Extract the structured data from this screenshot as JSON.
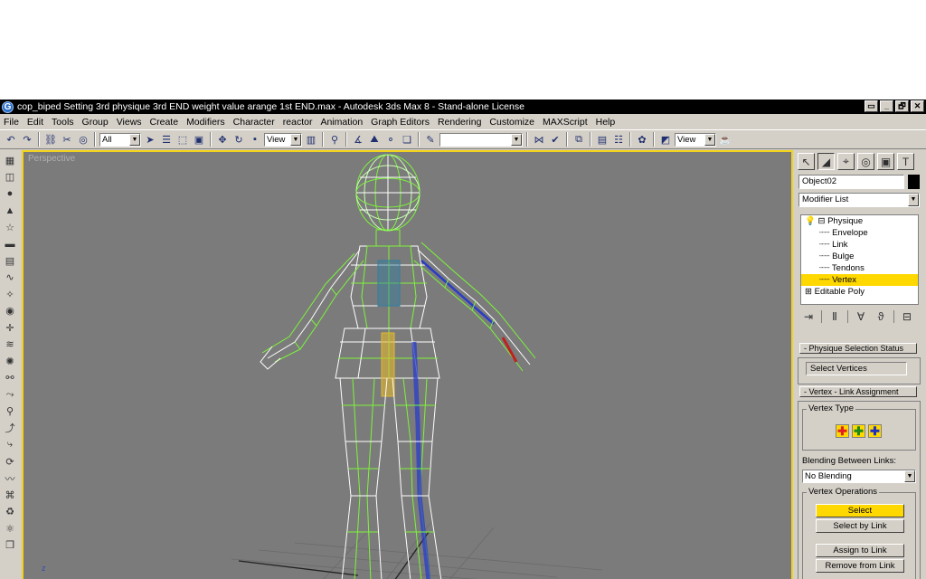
{
  "window": {
    "app_icon": "G",
    "title": "cop_biped Setting 3rd physique 3rd END weight value arange 1st END.max - Autodesk 3ds Max 8 - Stand-alone License",
    "controls": [
      "▭",
      "_",
      "🗗",
      "✕"
    ]
  },
  "menu": [
    "File",
    "Edit",
    "Tools",
    "Group",
    "Views",
    "Create",
    "Modifiers",
    "Character",
    "reactor",
    "Animation",
    "Graph Editors",
    "Rendering",
    "Customize",
    "MAXScript",
    "Help"
  ],
  "toolbar": {
    "selection_filter": "All",
    "coord_system": "View",
    "named_selection": "",
    "view_combo": "View",
    "icons": [
      "undo-icon",
      "redo-icon",
      "link-icon",
      "unlink-icon",
      "bind-space-warp-icon",
      "select-object-icon",
      "select-by-name-icon",
      "rect-selection-icon",
      "window-crossing-icon",
      "move-icon",
      "rotate-icon",
      "scale-icon",
      "pivot-icon",
      "mirror-icon",
      "align-icon",
      "layer-manager-icon",
      "curve-editor-icon",
      "schematic-icon",
      "material-editor-icon",
      "render-scene-icon",
      "quick-render-icon"
    ]
  },
  "viewport": {
    "label": "Perspective",
    "axis_label": "z",
    "border_color": "#f2d21a",
    "bg_color": "#7b7b7b"
  },
  "command_panel": {
    "tab_icons": [
      "create-tab-icon",
      "modify-tab-icon",
      "hierarchy-tab-icon",
      "motion-tab-icon",
      "display-tab-icon",
      "utilities-tab-icon"
    ],
    "object_name": "Object02",
    "object_color": "#000000",
    "modifier_list": "Modifier List",
    "stack": [
      {
        "prefix": "💡⊟",
        "label": "Physique",
        "indent": 0,
        "selected": false
      },
      {
        "prefix": "····",
        "label": "Envelope",
        "indent": 1,
        "selected": false
      },
      {
        "prefix": "····",
        "label": "Link",
        "indent": 1,
        "selected": false
      },
      {
        "prefix": "····",
        "label": "Bulge",
        "indent": 1,
        "selected": false
      },
      {
        "prefix": "····",
        "label": "Tendons",
        "indent": 1,
        "selected": false
      },
      {
        "prefix": "····",
        "label": "Vertex",
        "indent": 1,
        "selected": true
      },
      {
        "prefix": "⊞",
        "label": "Editable Poly",
        "indent": 0,
        "selected": false
      }
    ],
    "selection_status_title": "- Physique Selection Status",
    "select_vertices": "Select Vertices",
    "link_assignment_title": "- Vertex - Link Assignment",
    "vertex_type_label": "Vertex Type",
    "vertex_type_buttons": [
      {
        "glyph": "✚",
        "color": "#e02020"
      },
      {
        "glyph": "✚",
        "color": "#1a8a1a"
      },
      {
        "glyph": "✚",
        "color": "#2030c0"
      }
    ],
    "blending_label": "Blending Between Links:",
    "blending_value": "No Blending",
    "vertex_ops_label": "Vertex Operations",
    "select_btn": "Select",
    "select_by_link_btn": "Select by Link",
    "assign_to_link_btn": "Assign to Link",
    "remove_from_link_btn": "Remove from Link",
    "highlight_color": "#ffd800"
  }
}
